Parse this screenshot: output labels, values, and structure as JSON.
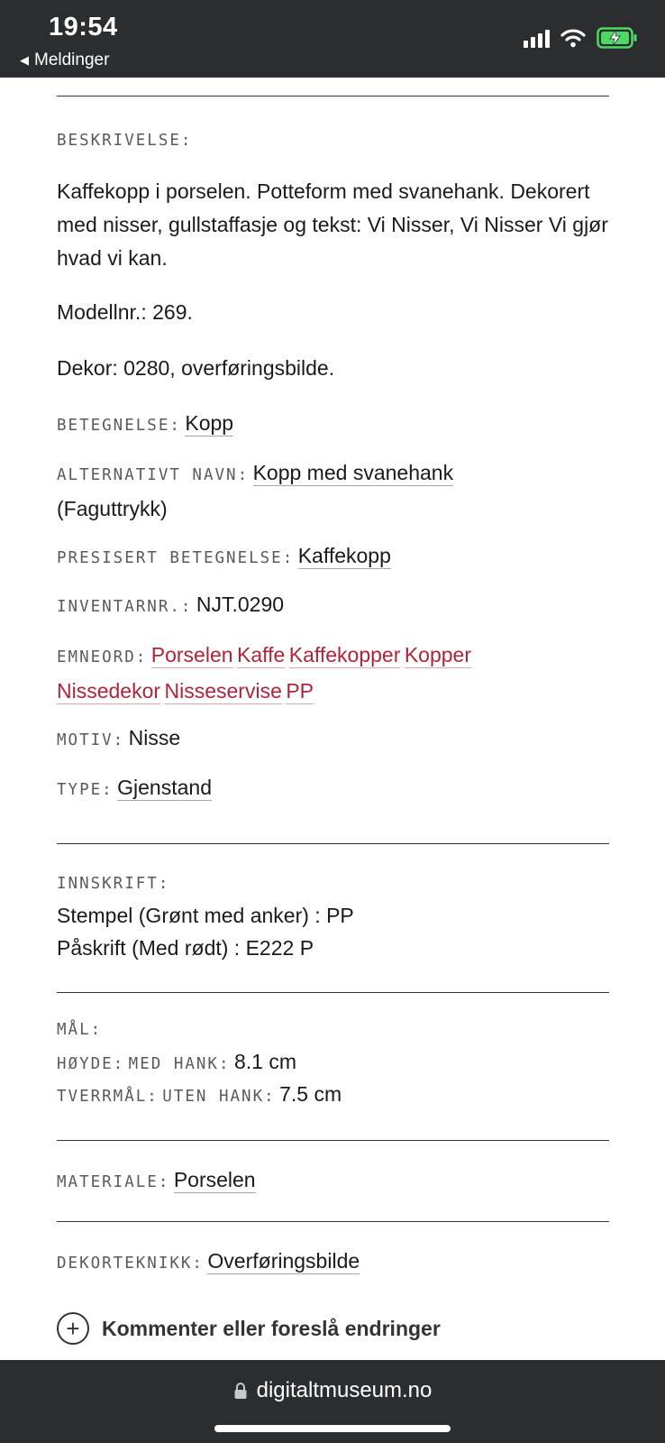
{
  "status_bar": {
    "time": "19:54",
    "back_app": "Meldinger",
    "icons": [
      "signal-icon",
      "wifi-icon",
      "battery-charging-icon"
    ]
  },
  "description": {
    "label": "BESKRIVELSE:",
    "text": "Kaffekopp i porselen. Potteform med svanehank. Dekorert med nisser, gullstaffasje og tekst: Vi Nisser, Vi Nisser Vi gjør hvad vi kan.",
    "model": "Modellnr.: 269.",
    "decor": "Dekor: 0280, overføringsbilde."
  },
  "fields": {
    "betegnelse": {
      "label": "BETEGNELSE:",
      "value": "Kopp"
    },
    "alternativt_navn": {
      "label": "ALTERNATIVT NAVN:",
      "value": "Kopp med svanehank",
      "suffix": "(Faguttrykk)"
    },
    "presisert": {
      "label": "PRESISERT BETEGNELSE:",
      "value": "Kaffekopp"
    },
    "inventarnr": {
      "label": "INVENTARNR.:",
      "value": "NJT.0290"
    },
    "emneord": {
      "label": "EMNEORD:",
      "tags": [
        "Porselen",
        "Kaffe",
        "Kaffekopper",
        "Kopper",
        "Nissedekor",
        "Nisseservise",
        "PP"
      ]
    },
    "motiv": {
      "label": "MOTIV:",
      "value": "Nisse"
    },
    "type": {
      "label": "TYPE:",
      "value": "Gjenstand"
    }
  },
  "inscription": {
    "label": "INNSKRIFT:",
    "lines": [
      "Stempel (Grønt med anker) : PP",
      "Påskrift (Med rødt) : E222 P"
    ]
  },
  "measurements": {
    "label": "MÅL:",
    "height_label": "HØYDE:",
    "height_sub": "MED HANK:",
    "height_value": "8.1 cm",
    "diameter_label": "TVERRMÅL:",
    "diameter_sub": "UTEN HANK:",
    "diameter_value": "7.5 cm"
  },
  "material": {
    "label": "MATERIALE:",
    "value": "Porselen"
  },
  "technique": {
    "label": "DEKORTEKNIKK:",
    "value": "Overføringsbilde"
  },
  "comment_action": "Kommenter eller foreslå endringer",
  "browser": {
    "url": "digitaltmuseum.no"
  },
  "colors": {
    "tag_red": "#b0243a",
    "bar_dark": "#2b2d31"
  }
}
